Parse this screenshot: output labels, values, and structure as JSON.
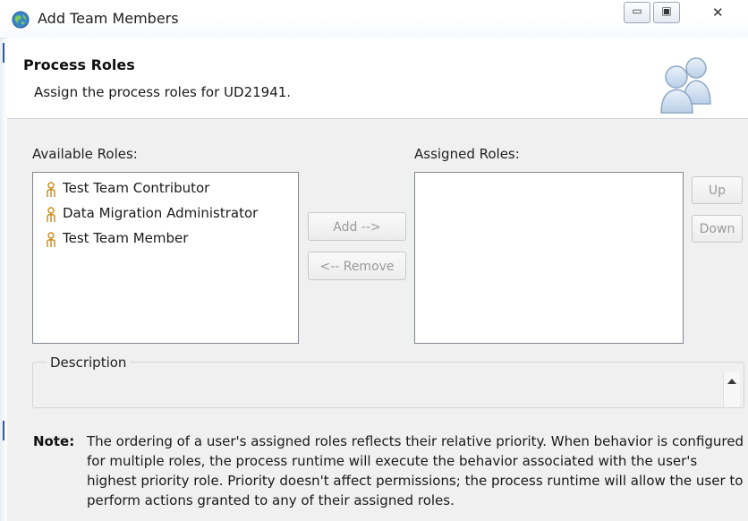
{
  "window": {
    "title": "Add Team Members",
    "min_glyph": "▭",
    "max_glyph": "▣",
    "close_glyph": "✕"
  },
  "header": {
    "title": "Process Roles",
    "subtitle": "Assign the process roles for UD21941."
  },
  "available": {
    "label": "Available Roles:",
    "items": [
      {
        "label": "Test Team Contributor"
      },
      {
        "label": "Data Migration Administrator"
      },
      {
        "label": "Test Team Member"
      }
    ]
  },
  "assigned": {
    "label": "Assigned Roles:",
    "items": []
  },
  "buttons": {
    "add": "Add -->",
    "remove": "<-- Remove",
    "up": "Up",
    "down": "Down"
  },
  "description": {
    "label": "Description",
    "value": ""
  },
  "note": {
    "label": "Note:",
    "text": "The ordering of a user's assigned roles reflects their relative priority. When behavior is configured for multiple roles, the process runtime will execute the behavior associated with the user's highest priority role. Priority doesn't affect permissions; the process runtime will allow the user to perform actions granted to any of their assigned roles."
  },
  "icons": {
    "app": "globe-icon",
    "header": "people-icon",
    "role": "role-person-icon"
  },
  "colors": {
    "role_icon": "#c98a1a",
    "disabled_text": "#9a9a9a"
  }
}
